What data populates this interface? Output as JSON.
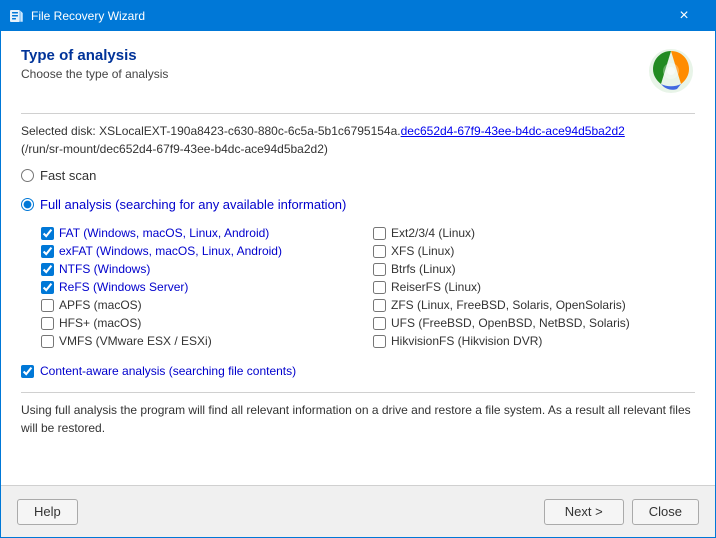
{
  "window": {
    "title": "File Recovery Wizard",
    "close_label": "×"
  },
  "header": {
    "title": "Type of analysis",
    "subtitle": "Choose the type of analysis"
  },
  "selected_disk_label": "Selected disk:",
  "selected_disk_name": "XSLocalEXT-190a8423-c630-880c-6c5a-5b1c6795154a.",
  "selected_disk_link": "dec652d4-67f9-43ee-b4dc-ace94d5ba2d2",
  "selected_disk_path": "(/run/sr-mount/dec652d4-67f9-43ee-b4dc-ace94d5ba2d2)",
  "fast_scan_label": "Fast scan",
  "full_analysis_label": "Full analysis (searching for any available information)",
  "checkboxes": [
    {
      "id": "fat",
      "label": "FAT (Windows, macOS, Linux, Android)",
      "checked": true,
      "blue": true,
      "col": 0
    },
    {
      "id": "ext234",
      "label": "Ext2/3/4 (Linux)",
      "checked": false,
      "blue": false,
      "col": 1
    },
    {
      "id": "exfat",
      "label": "exFAT (Windows, macOS, Linux, Android)",
      "checked": true,
      "blue": true,
      "col": 0
    },
    {
      "id": "xfs",
      "label": "XFS (Linux)",
      "checked": false,
      "blue": false,
      "col": 1
    },
    {
      "id": "ntfs",
      "label": "NTFS (Windows)",
      "checked": true,
      "blue": true,
      "col": 0
    },
    {
      "id": "btrfs",
      "label": "Btrfs (Linux)",
      "checked": false,
      "blue": false,
      "col": 1
    },
    {
      "id": "refs",
      "label": "ReFS (Windows Server)",
      "checked": true,
      "blue": true,
      "col": 0
    },
    {
      "id": "reiserfs",
      "label": "ReiserFS (Linux)",
      "checked": false,
      "blue": false,
      "col": 1
    },
    {
      "id": "apfs",
      "label": "APFS (macOS)",
      "checked": false,
      "blue": false,
      "col": 0
    },
    {
      "id": "zfs",
      "label": "ZFS (Linux, FreeBSD, Solaris, OpenSolaris)",
      "checked": false,
      "blue": false,
      "col": 1
    },
    {
      "id": "hfsplus",
      "label": "HFS+ (macOS)",
      "checked": false,
      "blue": false,
      "col": 0
    },
    {
      "id": "ufs",
      "label": "UFS (FreeBSD, OpenBSD, NetBSD, Solaris)",
      "checked": false,
      "blue": false,
      "col": 1
    },
    {
      "id": "vmfs",
      "label": "VMFS (VMware ESX / ESXi)",
      "checked": false,
      "blue": false,
      "col": 0
    },
    {
      "id": "hikvision",
      "label": "HikvisionFS (Hikvision DVR)",
      "checked": false,
      "blue": false,
      "col": 1
    }
  ],
  "content_aware_label": "Content-aware analysis (searching file contents)",
  "content_aware_checked": true,
  "description": "Using full analysis the program will find all relevant information on a drive and restore a file system. As a result all relevant files will be restored.",
  "footer": {
    "help_label": "Help",
    "next_label": "Next >",
    "close_label": "Close"
  }
}
